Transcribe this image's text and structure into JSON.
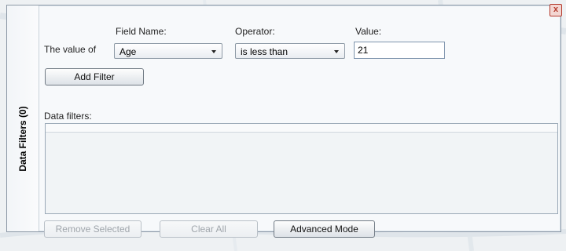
{
  "panel": {
    "side_tab_label": "Data Filters (0)",
    "close_glyph": "x"
  },
  "filter_builder": {
    "prefix_label": "The value of",
    "field_name_label": "Field Name:",
    "operator_label": "Operator:",
    "value_label": "Value:",
    "field_name_selected": "Age",
    "operator_selected": "is less than",
    "value": "21",
    "add_filter_label": "Add Filter"
  },
  "data_filters": {
    "label": "Data filters:",
    "items": []
  },
  "footer": {
    "remove_selected_label": "Remove Selected",
    "clear_all_label": "Clear All",
    "advanced_mode_label": "Advanced Mode"
  },
  "icons": {
    "close": "close-icon",
    "dropdown": "chevron-down-icon"
  },
  "colors": {
    "close_red": "#b43a2c",
    "disabled_text": "#a0a6ac"
  }
}
